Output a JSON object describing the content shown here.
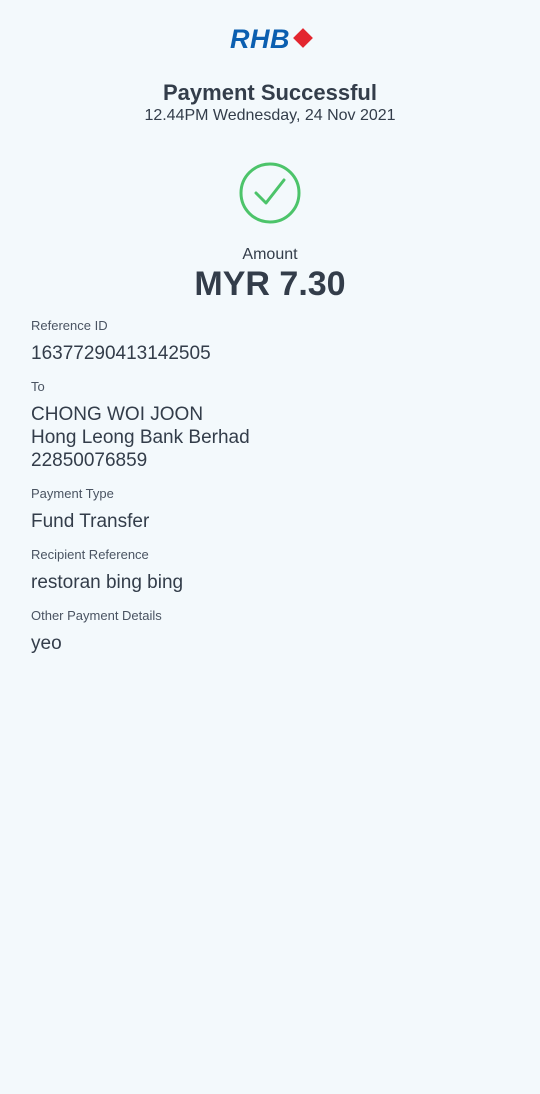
{
  "header": {
    "logo_text": "RHB",
    "logo_icon": "rhb-diamond-icon",
    "title": "Payment Successful",
    "datetime": "12.44PM Wednesday, 24 Nov 2021"
  },
  "status": {
    "icon": "check-circle-icon",
    "color": "#4cc46a"
  },
  "amount": {
    "label": "Amount",
    "value": "MYR 7.30"
  },
  "details": {
    "reference_id": {
      "label": "Reference ID",
      "value": "16377290413142505"
    },
    "to": {
      "label": "To",
      "name": "CHONG WOI JOON",
      "bank": "Hong Leong Bank Berhad",
      "account": "22850076859"
    },
    "payment_type": {
      "label": "Payment Type",
      "value": "Fund Transfer"
    },
    "recipient_reference": {
      "label": "Recipient Reference",
      "value": "restoran bing bing"
    },
    "other_details": {
      "label": "Other Payment Details",
      "value": "yeo"
    }
  },
  "colors": {
    "brand_blue": "#0b5fb0",
    "brand_red": "#e3262f",
    "success_green": "#4cc46a",
    "background": "#f3f9fc",
    "text": "#333d4a"
  }
}
